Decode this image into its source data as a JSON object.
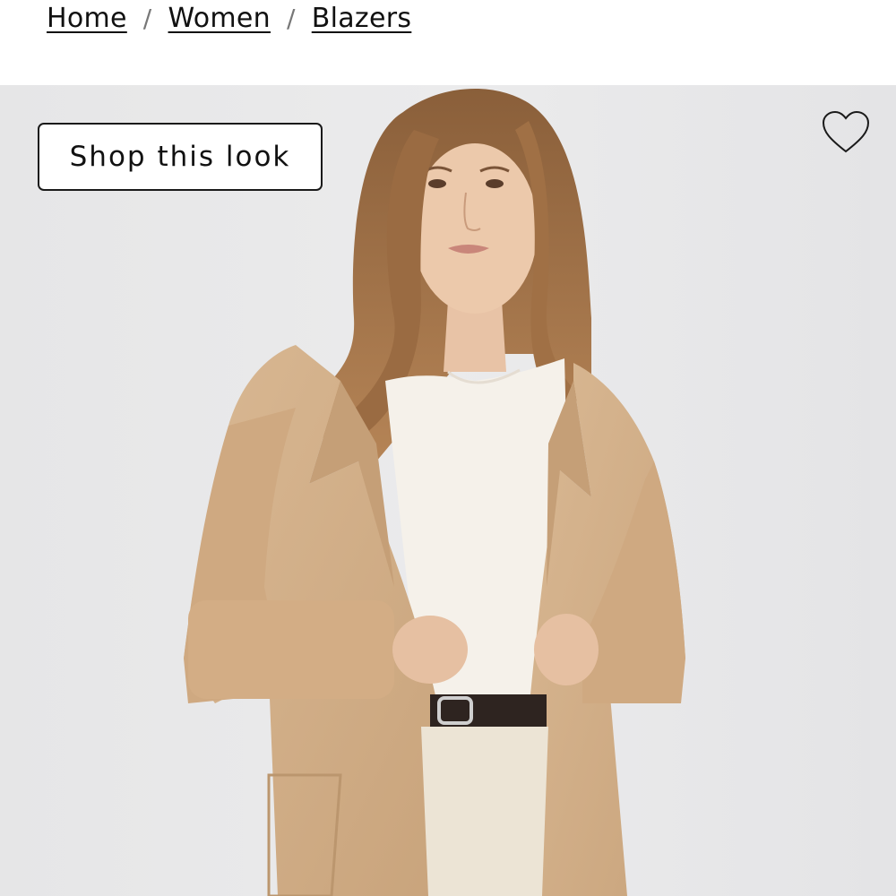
{
  "breadcrumb": {
    "items": [
      {
        "label": "Home"
      },
      {
        "label": "Women"
      },
      {
        "label": "Blazers"
      }
    ],
    "separator": "/"
  },
  "product_image": {
    "shop_this_look_label": "Shop this look",
    "favorite_icon": "heart-outline-icon",
    "background_color": "#e9e9ea",
    "garment_color": "#d6b48f"
  }
}
